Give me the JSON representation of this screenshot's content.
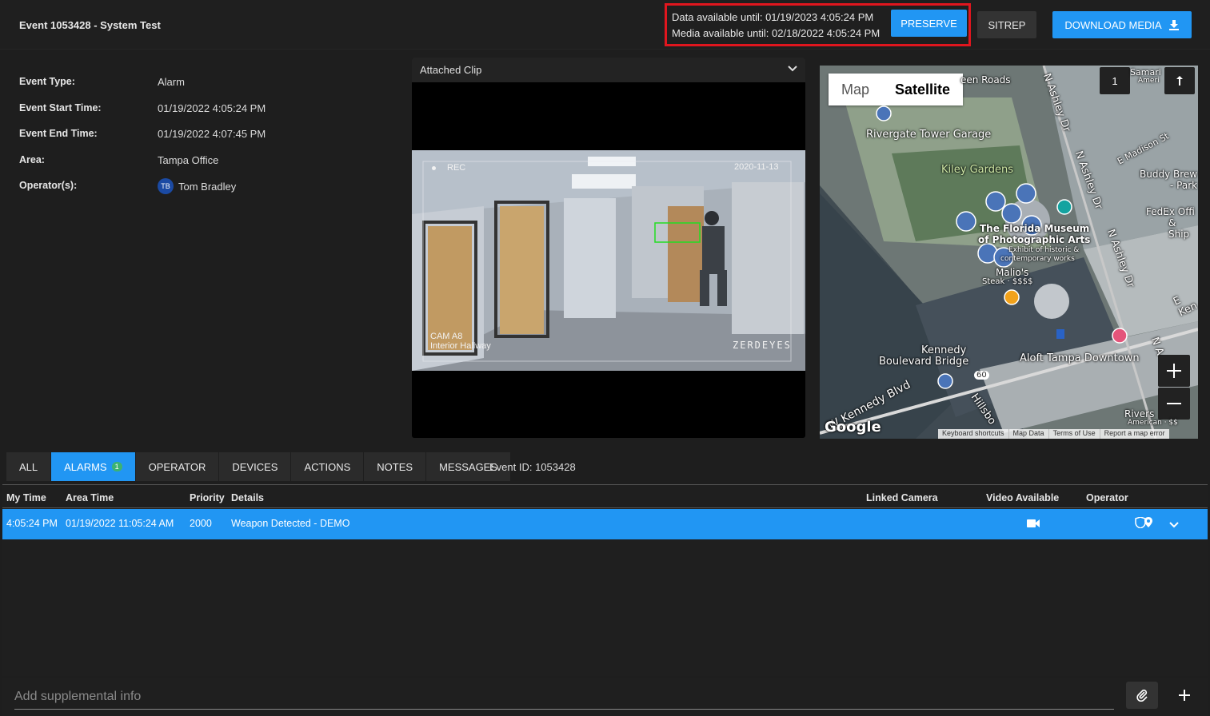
{
  "header": {
    "title": "Event 1053428 - System Test",
    "data_available": "Data available until: 01/19/2023 4:05:24 PM",
    "media_available": "Media available until: 02/18/2022 4:05:24 PM",
    "preserve_label": "PRESERVE",
    "sitrep_label": "SITREP",
    "download_label": "DOWNLOAD MEDIA"
  },
  "details": [
    {
      "label": "Event Type:",
      "value": "Alarm"
    },
    {
      "label": "Event Start Time:",
      "value": "01/19/2022 4:05:24 PM"
    },
    {
      "label": "Event End Time:",
      "value": "01/19/2022 4:07:45 PM"
    },
    {
      "label": "Area:",
      "value": "Tampa Office"
    },
    {
      "label": "Operator(s):",
      "value": "Tom Bradley",
      "avatar": "TB"
    }
  ],
  "clip": {
    "title": "Attached Clip",
    "rec": "REC",
    "date": "2020-11-13",
    "cam": "CAM A8",
    "location": "Interior Hallway",
    "watermark": "ZERDEYES"
  },
  "map": {
    "map_label": "Map",
    "satellite_label": "Satellite",
    "count": "1",
    "labels": {
      "rivergate": "Rivergate Tower Garage",
      "kiley": "Kiley Gardens",
      "museum1": "The Florida Museum",
      "museum2": "of Photographic Arts",
      "museum3": "Exhibit of historic &",
      "museum4": "contemporary works",
      "malios1": "Malio's",
      "malios2": "Steak · $$$$",
      "kennedy1": "Kennedy",
      "kennedy2": "Boulevard Bridge",
      "aloft": "Aloft Tampa Downtown",
      "ashley1": "N Ashley Dr",
      "ashley2": "N Ashley Dr",
      "ashley3": "N Ashley Dr",
      "madison": "E Madison St",
      "buddy1": "Buddy Brew",
      "buddy2": "- Park",
      "fedex1": "FedEx Offi",
      "fedex2": "& Ship",
      "ekennedy": "E Ken",
      "wkennedy": "W Kennedy Blvd",
      "hillsb": "Hillsbo",
      "route": "60",
      "rivers1": "Rivers",
      "rivers2": "American · $$",
      "samari1": "Samari",
      "samari2": "Ameri",
      "een": "een Roads",
      "na": "N A",
      "google": "Google"
    },
    "attribution": [
      "Keyboard shortcuts",
      "Map Data",
      "Terms of Use",
      "Report a map error"
    ]
  },
  "tabs": [
    {
      "label": "ALL"
    },
    {
      "label": "ALARMS",
      "badge": "1"
    },
    {
      "label": "OPERATOR"
    },
    {
      "label": "DEVICES"
    },
    {
      "label": "ACTIONS"
    },
    {
      "label": "NOTES"
    },
    {
      "label": "MESSAGES"
    }
  ],
  "event_id": "Event ID: 1053428",
  "table": {
    "columns": [
      "My Time",
      "Area Time",
      "Priority",
      "Details",
      "Linked Camera",
      "Video Available",
      "Operator"
    ],
    "rows": [
      {
        "my_time": "4:05:24 PM",
        "area_time": "01/19/2022 11:05:24 AM",
        "priority": "2000",
        "details": "Weapon Detected - DEMO"
      }
    ]
  },
  "footer": {
    "placeholder": "Add supplemental info"
  },
  "colors": {
    "accent": "#2196f3",
    "highlight_box": "#e0161e",
    "badge": "#3cb371"
  }
}
